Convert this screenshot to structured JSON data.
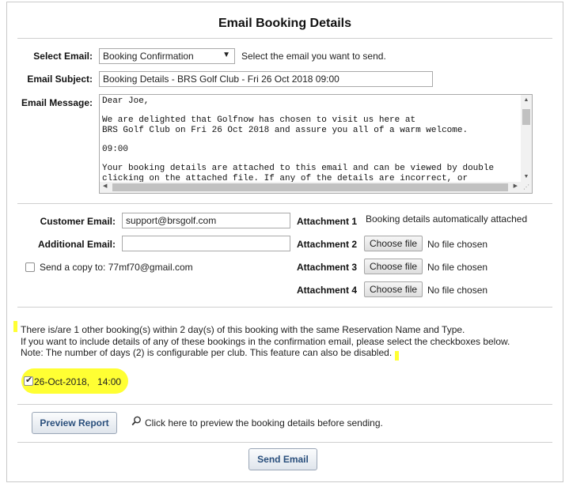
{
  "title": "Email Booking Details",
  "email_section": {
    "select_email_label": "Select Email:",
    "select_email_value": "Booking Confirmation",
    "select_email_hint": "Select the email you want to send.",
    "subject_label": "Email Subject:",
    "subject_value": "Booking Details - BRS Golf Club - Fri 26 Oct 2018 09:00",
    "message_label": "Email Message:",
    "message_text": "Dear Joe,\n\nWe are delighted that Golfnow has chosen to visit us here at\nBRS Golf Club on Fri 26 Oct 2018 and assure you all of a warm welcome.\n\n09:00\n\nYour booking details are attached to this email and can be viewed by double\nclicking on the attached file. If any of the details are incorrect, or"
  },
  "recipients": {
    "customer_email_label": "Customer Email:",
    "customer_email_value": "support@brsgolf.com",
    "additional_email_label": "Additional Email:",
    "additional_email_value": "",
    "send_copy_label": "Send a copy to: 77mf70@gmail.com",
    "send_copy_checked": false
  },
  "attachments": [
    {
      "label": "Attachment 1",
      "status": "Booking details automatically attached"
    },
    {
      "label": "Attachment 2",
      "button": "Choose file",
      "status": "No file chosen"
    },
    {
      "label": "Attachment 3",
      "button": "Choose file",
      "status": "No file chosen"
    },
    {
      "label": "Attachment 4",
      "button": "Choose file",
      "status": "No file chosen"
    }
  ],
  "other_bookings": {
    "line1": "There is/are 1 other booking(s) within 2 day(s) of this booking with the same Reservation Name and Type.",
    "line2": "If you want to include details of any of these bookings in the confirmation email, please select the checkboxes below.",
    "line3": "Note: The number of days (2) is configurable per club. This feature can also be disabled.",
    "booking_item": "26-Oct-2018,   14:00",
    "booking_checked": true
  },
  "actions": {
    "preview_button": "Preview Report",
    "preview_hint": "Click here to preview the booking details before sending.",
    "send_button": "Send Email"
  },
  "colors": {
    "highlight": "#ffff33",
    "button_text": "#2a4f7c",
    "border": "#c9c9c9"
  },
  "icons": {
    "preview_hint_icon": "magnifier-icon",
    "select_arrow": "dropdown-arrow-icon"
  }
}
